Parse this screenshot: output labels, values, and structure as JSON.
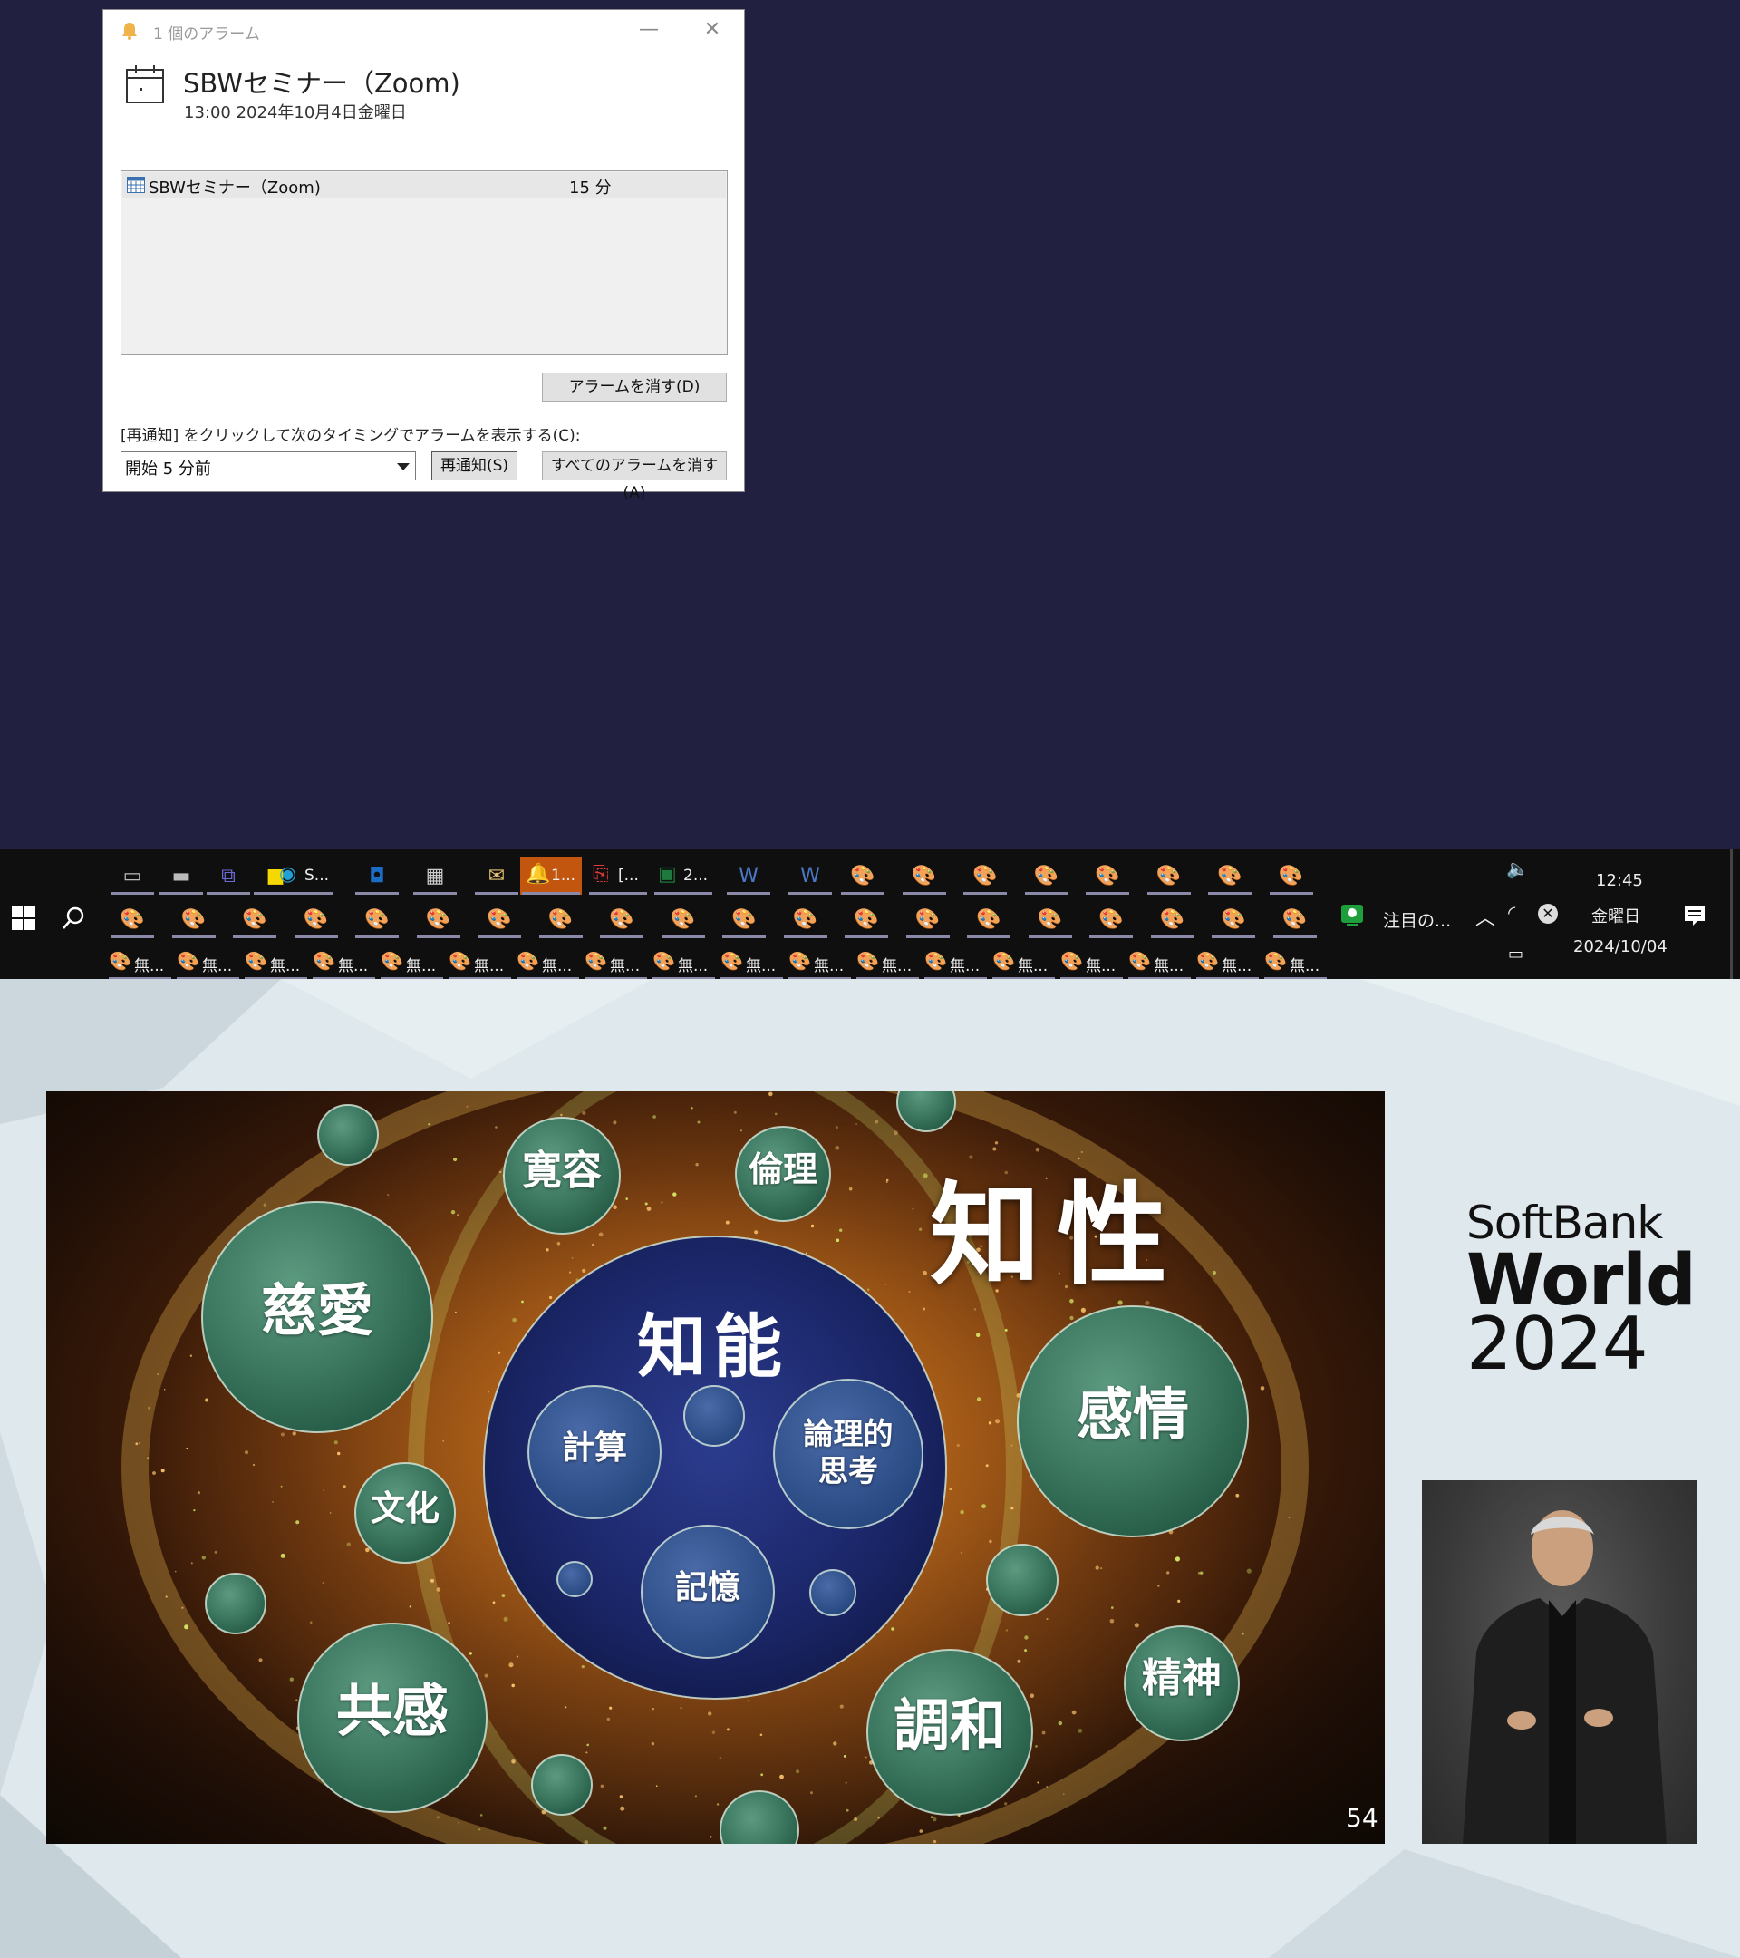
{
  "dialog": {
    "window_title": "1 個のアラーム",
    "subject": "SBWセミナー（Zoom)",
    "when": "13:00 2024年10月4日金曜日",
    "list": {
      "item_title": "SBWセミナー（Zoom)",
      "item_due": "15 分"
    },
    "dismiss_label": "アラームを消す(D)",
    "snooze_instruction": "[再通知] をクリックして次のタイミングでアラームを表示する(C):",
    "snooze_select_value": "開始 5 分前",
    "snooze_label": "再通知(S)",
    "dismiss_all_label": "すべてのアラームを消す(A)"
  },
  "taskbar": {
    "row1": [
      {
        "name": "terminal-icon",
        "glyph": "▭"
      },
      {
        "name": "window-icon",
        "glyph": "▬"
      },
      {
        "name": "teams-icon",
        "glyph": "⧉"
      },
      {
        "name": "sticky-notes-icon",
        "glyph": "■"
      },
      {
        "name": "edge-button",
        "glyph": "◉",
        "label": "S..."
      },
      {
        "name": "outlook-icon",
        "glyph": "◘"
      },
      {
        "name": "calendar-icon",
        "glyph": "▦"
      },
      {
        "name": "mail-icon",
        "glyph": "✉"
      },
      {
        "name": "reminder-button",
        "glyph": "🔔",
        "label": "1..."
      },
      {
        "name": "pdf-button",
        "glyph": "⎘",
        "label": "[..."
      },
      {
        "name": "excel-button",
        "glyph": "▣",
        "label": "2..."
      },
      {
        "name": "app-w-icon-1",
        "glyph": "W"
      },
      {
        "name": "app-w-icon-2",
        "glyph": "W"
      }
    ],
    "paint_glyph": "🎨",
    "row3_label": "無...",
    "notification_label": "注目の...",
    "clock": {
      "time": "12:45",
      "day": "金曜日",
      "date": "2024/10/04"
    }
  },
  "presentation": {
    "logo": {
      "line1": "SoftBank",
      "line2": "World",
      "line3": "2024"
    },
    "slide": {
      "main_title": "知性",
      "inner_title": "知能",
      "inner_bubbles": [
        "計算",
        "論理的\n思考",
        "記憶"
      ],
      "outer_bubbles": [
        "寛容",
        "倫理",
        "慈愛",
        "感情",
        "文化",
        "共感",
        "調和",
        "精神"
      ],
      "page_number": "54"
    }
  },
  "colors": {
    "desktop": "#212041",
    "taskbar": "#0f0f0f",
    "bubble_green": "#3e7a62",
    "inner_blue": "#1c2a6a",
    "reminder_orange": "#c2560f"
  }
}
